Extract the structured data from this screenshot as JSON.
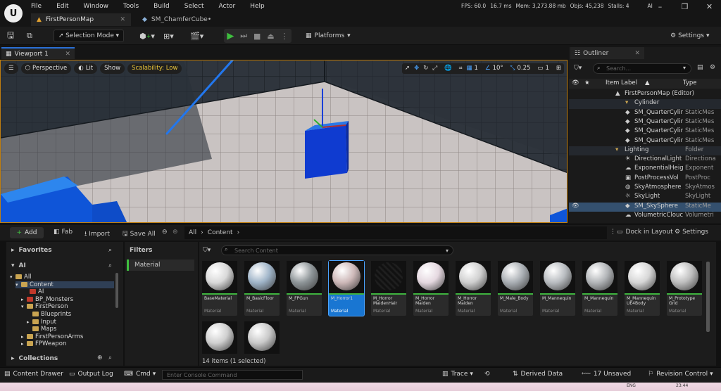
{
  "menu": [
    "File",
    "Edit",
    "Window",
    "Tools",
    "Build",
    "Select",
    "Actor",
    "Help"
  ],
  "tabs": {
    "map": "FirstPersonMap",
    "asset": "SM_ChamferCube•"
  },
  "stats": {
    "fps": "FPS: 60.0",
    "ms": "16.7 ms",
    "mem": "Mem: 3,273.88 mb",
    "objs": "Objs: 45,238",
    "stalls": "Stalls: 4",
    "ai": "AI"
  },
  "toolbar": {
    "selection_mode": "Selection Mode",
    "platforms": "Platforms",
    "settings": "Settings"
  },
  "viewport": {
    "tab": "Viewport 1",
    "perspective": "Perspective",
    "lit": "Lit",
    "show": "Show",
    "scalability": "Scalability: Low",
    "grid": "1",
    "angle": "10°",
    "scale": "0.25",
    "camera": "1"
  },
  "outliner": {
    "tab": "Outliner",
    "search_placeholder": "Search...",
    "col_label": "Item Label",
    "col_type": "Type",
    "rows": [
      {
        "label": "FirstPersonMap (Editor)",
        "type": ""
      },
      {
        "label": "Cylinder",
        "type": ""
      },
      {
        "label": "SM_QuarterCylir",
        "type": "StaticMes"
      },
      {
        "label": "SM_QuarterCylir",
        "type": "StaticMes"
      },
      {
        "label": "SM_QuarterCylir",
        "type": "StaticMes"
      },
      {
        "label": "SM_QuarterCylir",
        "type": "StaticMes"
      },
      {
        "label": "Lighting",
        "type": "Folder"
      },
      {
        "label": "DirectionalLight",
        "type": "Directiona"
      },
      {
        "label": "ExponentialHeig",
        "type": "Exponent"
      },
      {
        "label": "PostProcessVol",
        "type": "PostProc"
      },
      {
        "label": "SkyAtmosphere",
        "type": "SkyAtmos"
      },
      {
        "label": "SkyLight",
        "type": "SkyLight"
      },
      {
        "label": "SM_SkySphere",
        "type": "StaticMe"
      },
      {
        "label": "VolumetricClouc",
        "type": "Volumetri"
      }
    ]
  },
  "content_browser": {
    "add": "Add",
    "fab": "Fab",
    "import": "Import",
    "save_all": "Save All",
    "path": [
      "All",
      "Content"
    ],
    "dock": "Dock in Layout",
    "settings": "Settings",
    "favorites": "Favorites",
    "ai_section": "AI",
    "tree": [
      "All",
      "Content",
      "AI",
      "BP_Monsters",
      "FirstPerson",
      "Blueprints",
      "Input",
      "Maps",
      "FirstPersonArms",
      "FPWeapon"
    ],
    "collections": "Collections",
    "filters": "Filters",
    "filter_item": "Material",
    "search_placeholder": "Search Content",
    "items_count": "14 items (1 selected)",
    "assets": [
      {
        "name": "BaseMaterial",
        "type": "Material",
        "color": "#d9d9d9"
      },
      {
        "name": "M_BasicFloor",
        "type": "Material",
        "color": "#9fb4c8"
      },
      {
        "name": "M_FPGun",
        "type": "Material",
        "color": "#8e9598"
      },
      {
        "name": "M_Horror1",
        "type": "Material",
        "color": "#cdb8b8"
      },
      {
        "name": "M_Horror MaidenHair",
        "type": "Material",
        "color": "#151515"
      },
      {
        "name": "M_Horror Maiden",
        "type": "Material",
        "color": "#e5d8e0"
      },
      {
        "name": "M_Horror Maiden",
        "type": "Material",
        "color": "#cfcfcf"
      },
      {
        "name": "M_Male_Body",
        "type": "Material",
        "color": "#a9aeb3"
      },
      {
        "name": "M_Mannequin",
        "type": "Material",
        "color": "#b8bcc0"
      },
      {
        "name": "M_Mannequin",
        "type": "Material",
        "color": "#b2b5b8"
      },
      {
        "name": "M_Mannequin UE4Body",
        "type": "Material",
        "color": "#d6d6d6"
      },
      {
        "name": "M_Prototype Grid",
        "type": "Material",
        "color": "#bdbdbd"
      },
      {
        "name": "",
        "type": "",
        "color": "#cfcfcf"
      },
      {
        "name": "",
        "type": "",
        "color": "#c9c9c9"
      }
    ]
  },
  "statusbar": {
    "content_drawer": "Content Drawer",
    "output_log": "Output Log",
    "cmd": "Cmd",
    "console_placeholder": "Enter Console Command",
    "trace": "Trace",
    "derived_data": "Derived Data",
    "unsaved": "17 Unsaved",
    "revision": "Revision Control"
  },
  "taskbar": {
    "lang": "ENG",
    "time": "23:44"
  }
}
